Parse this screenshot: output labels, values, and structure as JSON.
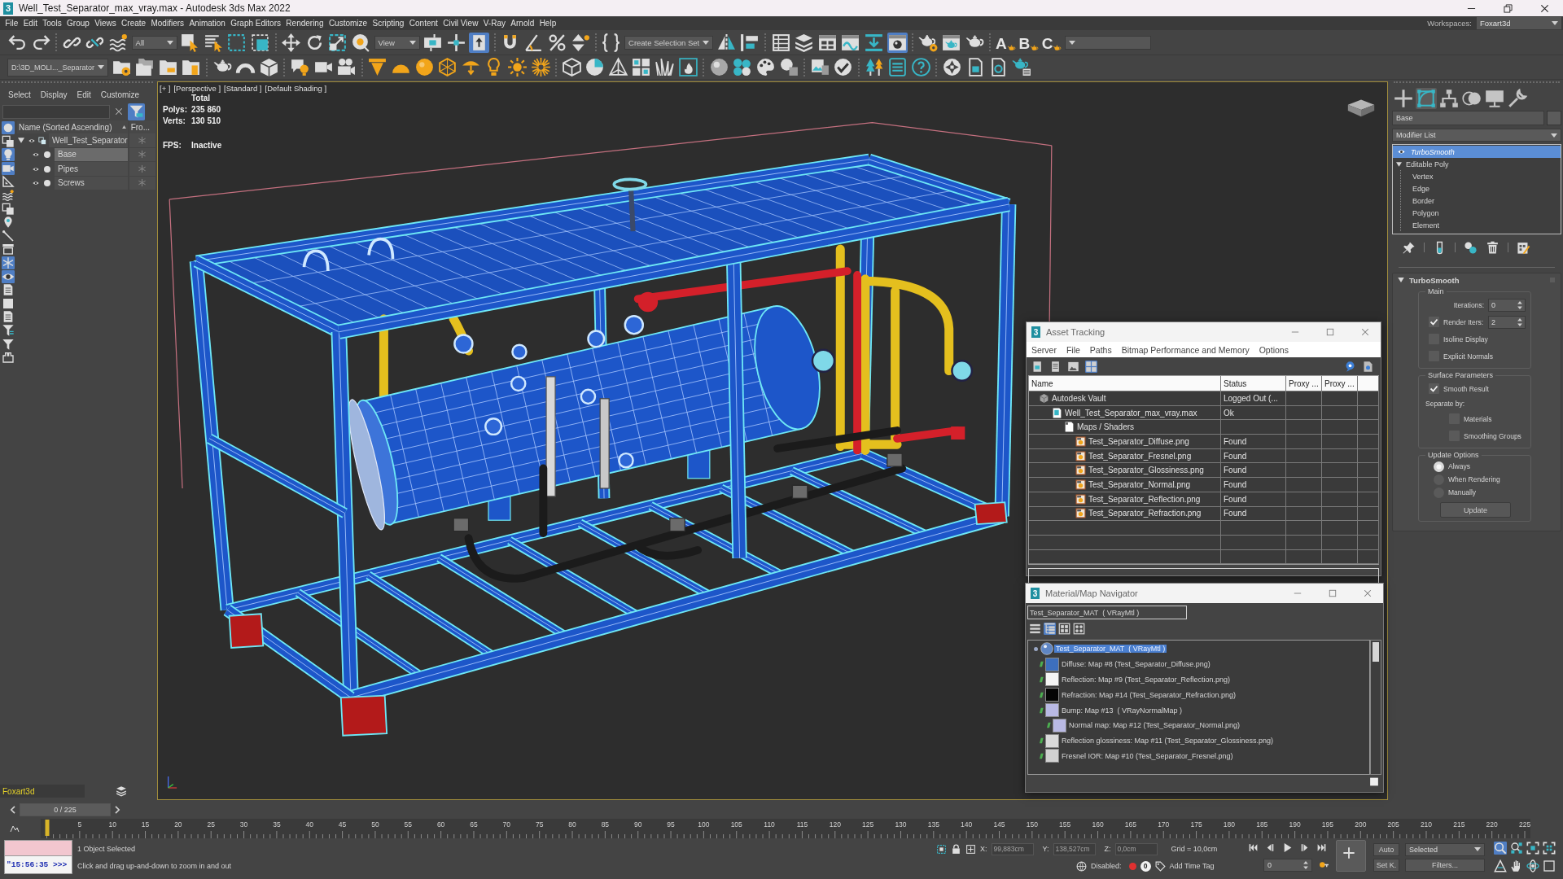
{
  "window": {
    "logo": "3",
    "title": "Well_Test_Separator_max_vray.max - Autodesk 3ds Max 2022"
  },
  "menu_bar": {
    "items": [
      "File",
      "Edit",
      "Tools",
      "Group",
      "Views",
      "Create",
      "Modifiers",
      "Animation",
      "Graph Editors",
      "Rendering",
      "Customize",
      "Scripting",
      "Content",
      "Civil View",
      "V-Ray",
      "Arnold",
      "Help"
    ],
    "workspaces_label": "Workspaces:",
    "workspace": "Foxart3d"
  },
  "main_toolbar": [
    {
      "kind": "button",
      "selected": false
    },
    {
      "kind": "button",
      "selected": false
    },
    {
      "kind": "separator"
    },
    {
      "kind": "button",
      "selected": false
    },
    {
      "kind": "button",
      "selected": false
    },
    {
      "kind": "button",
      "selected": false
    },
    {
      "kind": "dropdown",
      "value": "All"
    },
    {
      "kind": "button",
      "selected": false
    },
    {
      "kind": "button",
      "selected": false
    },
    {
      "kind": "button",
      "selected": false
    },
    {
      "kind": "button",
      "selected": false
    },
    {
      "kind": "separator"
    },
    {
      "kind": "button",
      "selected": false
    },
    {
      "kind": "button",
      "selected": false
    },
    {
      "kind": "button",
      "selected": false
    },
    {
      "kind": "button",
      "selected": false
    },
    {
      "kind": "dropdown",
      "value": "View"
    },
    {
      "kind": "button",
      "selected": false
    },
    {
      "kind": "button",
      "selected": false
    },
    {
      "kind": "button",
      "selected": true
    },
    {
      "kind": "separator"
    },
    {
      "kind": "button",
      "selected": false
    },
    {
      "kind": "button",
      "selected": false
    },
    {
      "kind": "button",
      "selected": false
    },
    {
      "kind": "button",
      "selected": false
    },
    {
      "kind": "separator"
    },
    {
      "kind": "button",
      "selected": false
    },
    {
      "kind": "dropdown",
      "value": "Create Selection Set"
    },
    {
      "kind": "button",
      "selected": false
    },
    {
      "kind": "button",
      "selected": false
    },
    {
      "kind": "separator"
    },
    {
      "kind": "button",
      "selected": false
    },
    {
      "kind": "button",
      "selected": false
    },
    {
      "kind": "button",
      "selected": false
    },
    {
      "kind": "button",
      "selected": false
    },
    {
      "kind": "button",
      "selected": false
    },
    {
      "kind": "button",
      "selected": true
    },
    {
      "kind": "separator"
    },
    {
      "kind": "button",
      "selected": false
    },
    {
      "kind": "button",
      "selected": false
    },
    {
      "kind": "button",
      "selected": false
    },
    {
      "kind": "separator"
    },
    {
      "kind": "letter",
      "label": "A"
    },
    {
      "kind": "letter",
      "label": "B"
    },
    {
      "kind": "letter",
      "label": "C"
    },
    {
      "kind": "dropdown"
    }
  ],
  "second_toolbar": [
    {
      "kind": "dropdown",
      "value": "D:\\3D_MOLI..._Separator"
    },
    {
      "kind": "button",
      "selected": false
    },
    {
      "kind": "button",
      "selected": false
    },
    {
      "kind": "button",
      "selected": false
    },
    {
      "kind": "button",
      "selected": false
    },
    {
      "kind": "separator"
    },
    {
      "kind": "button",
      "selected": false
    },
    {
      "kind": "button",
      "selected": false
    },
    {
      "kind": "button",
      "selected": false
    },
    {
      "kind": "separator"
    },
    {
      "kind": "button",
      "selected": false
    },
    {
      "kind": "button",
      "selected": false
    },
    {
      "kind": "button",
      "selected": false
    },
    {
      "kind": "separator"
    },
    {
      "kind": "button",
      "selected": false
    },
    {
      "kind": "button",
      "selected": false
    },
    {
      "kind": "button",
      "selected": false
    },
    {
      "kind": "button",
      "selected": false
    },
    {
      "kind": "button",
      "selected": false
    },
    {
      "kind": "button",
      "selected": false
    },
    {
      "kind": "button",
      "selected": false
    },
    {
      "kind": "button",
      "selected": false
    },
    {
      "kind": "separator"
    },
    {
      "kind": "button",
      "selected": false
    },
    {
      "kind": "button",
      "selected": false
    },
    {
      "kind": "button",
      "selected": false
    },
    {
      "kind": "button",
      "selected": false
    },
    {
      "kind": "button",
      "selected": false
    },
    {
      "kind": "button",
      "selected": false
    },
    {
      "kind": "separator"
    },
    {
      "kind": "button",
      "selected": false
    },
    {
      "kind": "button",
      "selected": false
    },
    {
      "kind": "button",
      "selected": false
    },
    {
      "kind": "button",
      "selected": false
    },
    {
      "kind": "separator"
    },
    {
      "kind": "button",
      "selected": false
    },
    {
      "kind": "button",
      "selected": false
    },
    {
      "kind": "separator"
    },
    {
      "kind": "button",
      "selected": false
    },
    {
      "kind": "button",
      "selected": false
    },
    {
      "kind": "button",
      "selected": false
    },
    {
      "kind": "separator"
    },
    {
      "kind": "button",
      "selected": false
    },
    {
      "kind": "button",
      "selected": false
    },
    {
      "kind": "button",
      "selected": false
    },
    {
      "kind": "button",
      "selected": false
    }
  ],
  "scene_explorer": {
    "tabs": [
      "Select",
      "Display",
      "Edit",
      "Customize"
    ],
    "filter_active": true,
    "tool_buttons": [
      {
        "selected": true
      },
      {
        "selected": false
      },
      {
        "selected": true
      },
      {
        "selected": true
      },
      {
        "selected": false
      },
      {
        "selected": false
      },
      {
        "selected": false
      },
      {
        "selected": false
      },
      {
        "selected": false
      },
      {
        "selected": false
      },
      {
        "selected": true
      },
      {
        "selected": true
      },
      {
        "selected": false
      },
      {
        "selected": false
      },
      {
        "selected": false
      },
      {
        "selected": false
      },
      {
        "selected": false
      },
      {
        "selected": false
      }
    ],
    "columns": [
      "Name (Sorted Ascending)",
      "Fro..."
    ],
    "tree": [
      {
        "name": "Well_Test_Separator",
        "expanded": true,
        "selected": false,
        "children": [
          {
            "name": "Base",
            "selected": true
          },
          {
            "name": "Pipes",
            "selected": false
          },
          {
            "name": "Screws",
            "selected": false
          }
        ]
      }
    ]
  },
  "layer_bar": {
    "label": "Foxart3d"
  },
  "viewport": {
    "labels": [
      "[+ ]",
      "[Perspective ]",
      "[Standard ]",
      "[Default Shading ]"
    ],
    "stats": {
      "heading": "Total",
      "rows": [
        {
          "label": "Polys:",
          "value": "235 860"
        },
        {
          "label": "Verts:",
          "value": "130 510"
        }
      ],
      "fps_label": "FPS:",
      "fps_value": "Inactive"
    }
  },
  "command_panel": {
    "tabs": [
      {
        "selected": false
      },
      {
        "selected": true
      },
      {
        "selected": false
      },
      {
        "selected": false
      },
      {
        "selected": false
      },
      {
        "selected": false
      }
    ],
    "object_name": "Base",
    "modifier_list": "Modifier List",
    "stack": [
      {
        "kind": "modifier",
        "name": "TurboSmooth",
        "selected": true
      },
      {
        "kind": "object",
        "name": "Editable Poly",
        "selected": false,
        "expanded": true,
        "children": [
          {
            "name": "Vertex"
          },
          {
            "name": "Edge"
          },
          {
            "name": "Border"
          },
          {
            "name": "Polygon"
          },
          {
            "name": "Element"
          }
        ]
      }
    ],
    "rollout": {
      "title": "TurboSmooth",
      "expanded": true,
      "groups": [
        {
          "title": "Main",
          "controls": [
            {
              "kind": "spinner",
              "label": "Iterations:",
              "value": "0"
            },
            {
              "kind": "check_spinner",
              "label": "Render Iters:",
              "checked": true,
              "value": "2"
            },
            {
              "kind": "checkbox",
              "label": "Isoline Display",
              "checked": false
            },
            {
              "kind": "checkbox",
              "label": "Explicit Normals",
              "checked": false
            }
          ]
        },
        {
          "title": "Surface Parameters",
          "controls": [
            {
              "kind": "checkbox",
              "label": "Smooth Result",
              "checked": true
            },
            {
              "kind": "text",
              "label": "Separate by:",
              "children": [
                {
                  "kind": "checkbox",
                  "label": "Materials",
                  "checked": false
                },
                {
                  "kind": "checkbox",
                  "label": "Smoothing Groups",
                  "checked": false
                }
              ]
            }
          ]
        },
        {
          "title": "Update Options",
          "controls": [
            {
              "kind": "radio",
              "label": "Always",
              "selected": true
            },
            {
              "kind": "radio",
              "label": "When Rendering",
              "selected": false
            },
            {
              "kind": "radio",
              "label": "Manually",
              "selected": false
            },
            {
              "kind": "button",
              "label": "Update"
            }
          ]
        }
      ]
    }
  },
  "asset_tracking": {
    "logo": "3",
    "title": "Asset Tracking",
    "menu": [
      "Server",
      "File",
      "Paths",
      "Bitmap Performance and Memory",
      "Options"
    ],
    "toolbar": [
      {
        "selected": false
      },
      {
        "selected": false
      },
      {
        "selected": false
      },
      {
        "selected": true
      }
    ],
    "columns": [
      "Name",
      "Status",
      "Proxy ...",
      "Proxy ..."
    ],
    "rows": [
      {
        "kind": "vault",
        "name": "Autodesk Vault",
        "status": "Logged Out (...",
        "children": [
          {
            "kind": "scene",
            "name": "Well_Test_Separator_max_vray.max",
            "status": "Ok",
            "children": [
              {
                "kind": "folder",
                "name": "Maps / Shaders",
                "children": [
                  {
                    "kind": "bitmap",
                    "name": "Test_Separator_Diffuse.png",
                    "status": "Found"
                  },
                  {
                    "kind": "bitmap",
                    "name": "Test_Separator_Fresnel.png",
                    "status": "Found"
                  },
                  {
                    "kind": "bitmap",
                    "name": "Test_Separator_Glossiness.png",
                    "status": "Found"
                  },
                  {
                    "kind": "bitmap",
                    "name": "Test_Separator_Normal.png",
                    "status": "Found"
                  },
                  {
                    "kind": "bitmap",
                    "name": "Test_Separator_Reflection.png",
                    "status": "Found"
                  },
                  {
                    "kind": "bitmap",
                    "name": "Test_Separator_Refraction.png",
                    "status": "Found"
                  }
                ]
              }
            ]
          }
        ]
      }
    ]
  },
  "material_navigator": {
    "logo": "3",
    "title": "Material/Map Navigator",
    "field": "Test_Separator_MAT  ( VRayMtl )",
    "view_buttons": [
      {
        "selected": false
      },
      {
        "selected": true
      },
      {
        "selected": false
      },
      {
        "selected": false
      }
    ],
    "tree": [
      {
        "kind": "material",
        "name": "Test_Separator_MAT  ( VRayMtl )",
        "selected": true,
        "children": [
          {
            "kind": "map",
            "name": "Diffuse: Map #8 (Test_Separator_Diffuse.png)",
            "selected": false,
            "color": "#3d6fbd"
          },
          {
            "kind": "map",
            "name": "Reflection: Map #9 (Test_Separator_Reflection.png)",
            "selected": false,
            "color": "#f4f4f4"
          },
          {
            "kind": "map",
            "name": "Refraction: Map #14 (Test_Separator_Refraction.png)",
            "selected": false,
            "color": "#050505"
          },
          {
            "kind": "map",
            "name": "Bump: Map #13  ( VRayNormalMap )",
            "selected": false,
            "color": "#b9b9e4",
            "children": [
              {
                "kind": "map",
                "name": "Normal map: Map #12 (Test_Separator_Normal.png)",
                "selected": false,
                "color": "#b9b9e4"
              }
            ]
          },
          {
            "kind": "map",
            "name": "Reflection glossiness: Map #11 (Test_Separator_Glossiness.png)",
            "selected": false,
            "color": "#dadada"
          },
          {
            "kind": "map",
            "name": "Fresnel IOR: Map #10 (Test_Separator_Fresnel.png)",
            "selected": false,
            "color": "#d2d2d2"
          }
        ]
      }
    ]
  },
  "time_slider": {
    "label": "0 / 225"
  },
  "ruler": {
    "level": 0,
    "labels": [
      "5",
      "10",
      "15",
      "20",
      "25",
      "30",
      "35",
      "40",
      "45",
      "50",
      "55",
      "60",
      "65",
      "70",
      "75",
      "80",
      "85",
      "90",
      "95",
      "100",
      "105",
      "110",
      "115",
      "120",
      "125",
      "130",
      "135",
      "140",
      "145",
      "150",
      "155",
      "160",
      "165",
      "170",
      "175",
      "180",
      "185",
      "190",
      "195",
      "200",
      "205",
      "210",
      "215",
      "220",
      "225"
    ]
  },
  "status_bar": {
    "listener": "\"15:56:35 >>>",
    "selection": "1 Object Selected",
    "prompt": "Click and drag up-and-down to zoom in and out",
    "coords": [
      {
        "label": "X:",
        "value": "99,883cm"
      },
      {
        "label": "Y:",
        "value": "138,527cm"
      },
      {
        "label": "Z:",
        "value": "0,0cm"
      }
    ],
    "grid": "Grid = 10,0cm",
    "disabled_label": "Disabled:",
    "disabled_count": "0",
    "time_tag": "Add Time Tag",
    "frame": "0",
    "auto_key": "Auto",
    "key_filter": "Selected",
    "set_key": "Set K.",
    "filters": "Filters...",
    "nav_buttons": [
      {
        "selected": true
      },
      {
        "selected": false
      },
      {
        "selected": false
      },
      {
        "selected": false
      },
      {
        "selected": false
      },
      {
        "selected": false
      },
      {
        "selected": false
      },
      {
        "selected": false
      }
    ]
  }
}
